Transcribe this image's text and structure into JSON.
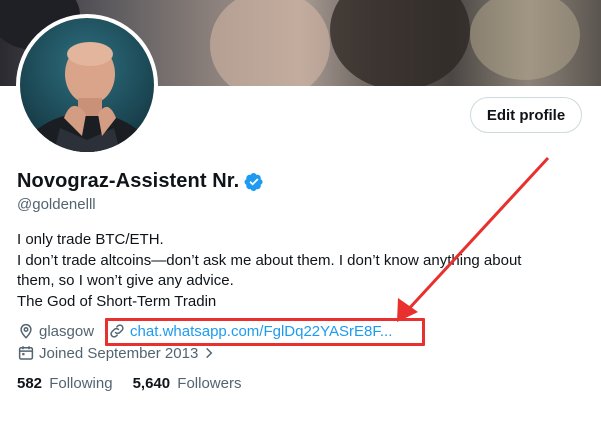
{
  "profile": {
    "name": "Novograz-Assistent Nr.",
    "handle": "@goldenelll",
    "edit_button": "Edit profile",
    "bio_lines": [
      "I only trade BTC/ETH.",
      "I don’t trade altcoins—don’t ask me about them. I don’t know anything about",
      "them, so I won’t give any advice.",
      "The God of Short-Term Tradin"
    ],
    "location": "glasgow",
    "link": "chat.whatsapp.com/FglDq22YASrE8F...",
    "joined": "Joined September 2013",
    "following_count": "582",
    "following_label": "Following",
    "followers_count": "5,640",
    "followers_label": "Followers"
  },
  "icons": {
    "verified": "verified-badge-icon",
    "location": "location-pin-icon",
    "link": "link-icon",
    "calendar": "calendar-icon",
    "chevron": "chevron-right-icon"
  },
  "colors": {
    "accent": "#1d9bf0",
    "secondary_text": "#536471",
    "annotation": "#e8302e"
  }
}
